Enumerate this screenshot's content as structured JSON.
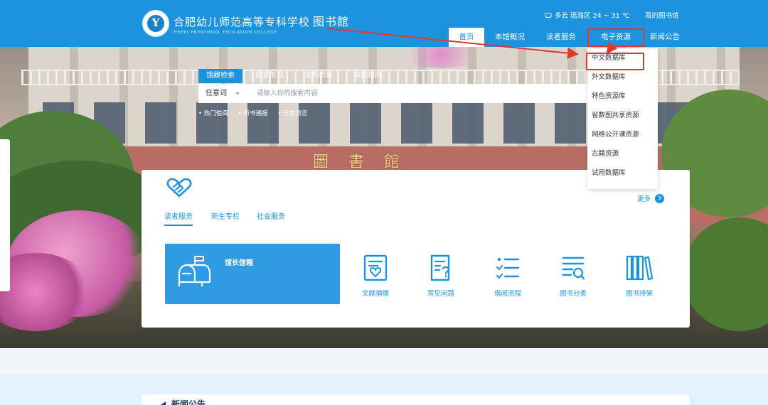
{
  "header": {
    "logo_cn": "合肥幼儿师范高等专科学校",
    "logo_lib": "图书館",
    "logo_en": "HEFEI PRESCHOOL EDUCATION COLLEGE",
    "weather": "多云 瑶海区 24 ~ 31 ℃",
    "my_library": "我的图书馆"
  },
  "nav": {
    "home": "首页",
    "about": "本馆概况",
    "readers": "读者服务",
    "eresources": "电子资源",
    "news": "新闻公告"
  },
  "dropdown": {
    "items": [
      "中文数据库",
      "外文数据库",
      "特色资源库",
      "省数图共享资源",
      "网络公开课资源",
      "古籍资源",
      "试用数据库"
    ]
  },
  "hero": {
    "sign": "圖書館"
  },
  "search": {
    "tabs": [
      "馆藏检索",
      "超星发现",
      "读秀检索",
      "中国知网"
    ],
    "scope": "任意词",
    "placeholder": "请输入你的搜索内容",
    "quick_links": [
      "热门借阅",
      "新书通报",
      "分类浏览"
    ]
  },
  "panel": {
    "more": "更多",
    "tabs": [
      "读者服务",
      "新生专栏",
      "社会服务"
    ],
    "mailbox": "馆长信箱",
    "services": [
      "文献捐赠",
      "常见问题",
      "借阅流程",
      "图书分类",
      "图书排架"
    ]
  },
  "bottom": {
    "title": "新闻公告"
  },
  "colors": {
    "brand": "#1d93e0",
    "highlight": "#e0392b"
  },
  "icons": [
    "handshake-icon",
    "weather-icon",
    "more-arrow-icon",
    "mailbox-icon",
    "donation-doc-icon",
    "faq-icon",
    "borrow-list-icon",
    "book-search-icon",
    "books-shelf-icon"
  ]
}
